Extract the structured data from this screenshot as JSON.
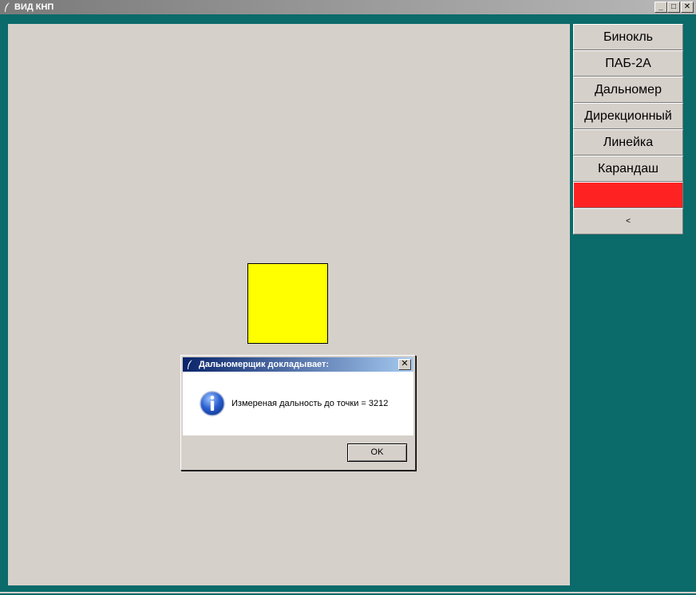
{
  "window": {
    "title": "ВИД КНП",
    "minimize_label": "_",
    "maximize_label": "□",
    "close_label": "✕"
  },
  "tools": [
    {
      "label": "Бинокль"
    },
    {
      "label": "ПАБ-2А"
    },
    {
      "label": "Дальномер"
    },
    {
      "label": "Дирекционный"
    },
    {
      "label": "Линейка"
    },
    {
      "label": "Карандаш"
    },
    {
      "label": ""
    },
    {
      "label": "<"
    }
  ],
  "colors": {
    "background": "#0b6a6a",
    "canvas": "#d6d0ca",
    "marker": "#ffff00",
    "color_button": "#ff2222"
  },
  "dialog": {
    "title": "Дальномерщик докладывает:",
    "close_label": "✕",
    "message": "Измереная дальность до точки = 3212",
    "ok_label": "OK",
    "icon": "info-icon"
  }
}
